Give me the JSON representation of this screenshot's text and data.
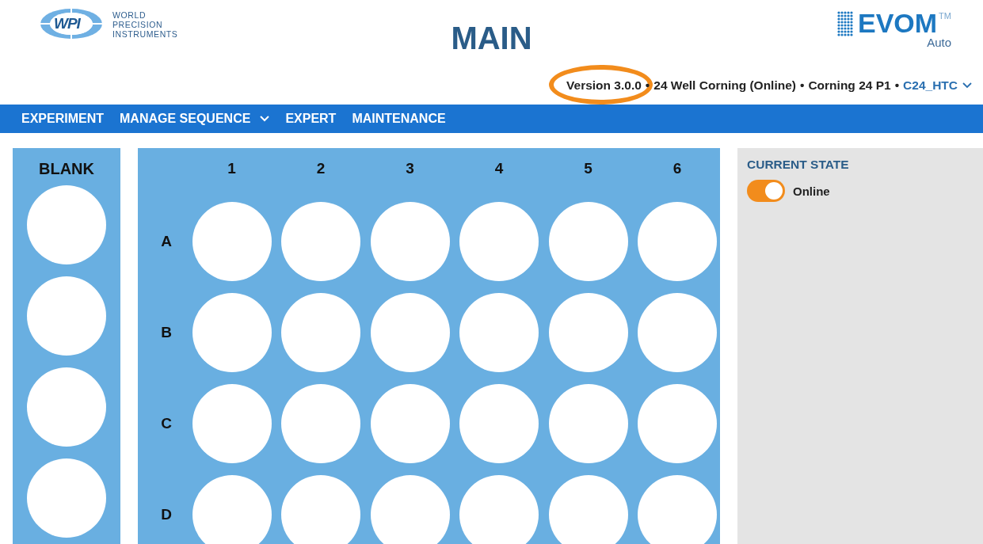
{
  "brand": {
    "mark": "WPI",
    "lines": [
      "WORLD",
      "PRECISION",
      "INSTRUMENTS"
    ]
  },
  "title": "MAIN",
  "product": {
    "name": "EVOM",
    "trademark": "TM",
    "sub": "Auto"
  },
  "info_line": [
    {
      "kind": "text",
      "text": "Version 3.0.0",
      "highlighted": true
    },
    {
      "kind": "separator",
      "text": "•",
      "highlighted": false
    },
    {
      "kind": "text",
      "text": "24 Well Corning (Online)",
      "highlighted": false
    },
    {
      "kind": "separator",
      "text": "•",
      "highlighted": false
    },
    {
      "kind": "text",
      "text": "Corning 24 P1",
      "highlighted": false
    },
    {
      "kind": "separator",
      "text": "•",
      "highlighted": false
    },
    {
      "kind": "dropdown",
      "text": "C24_HTC",
      "highlighted": false
    }
  ],
  "nav": [
    {
      "label": "EXPERIMENT",
      "dropdown": false
    },
    {
      "label": "MANAGE SEQUENCE",
      "dropdown": true
    },
    {
      "label": "EXPERT",
      "dropdown": false
    },
    {
      "label": "MAINTENANCE",
      "dropdown": false
    }
  ],
  "blank": {
    "title": "BLANK"
  },
  "plate": {
    "columns": [
      "1",
      "2",
      "3",
      "4",
      "5",
      "6"
    ],
    "rows": [
      "A",
      "B",
      "C",
      "D"
    ]
  },
  "current_state": {
    "title": "CURRENT STATE",
    "label": "Online",
    "on": true
  }
}
